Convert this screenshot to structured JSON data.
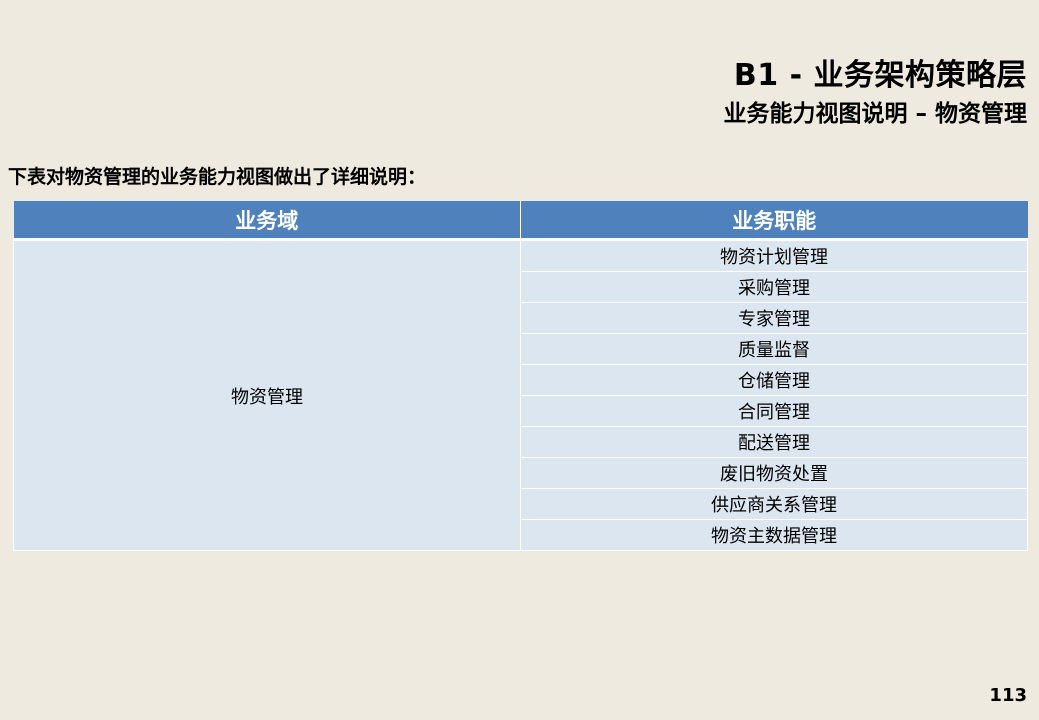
{
  "header": {
    "title": "B1 - 业务架构策略层",
    "subtitle": "业务能力视图说明 – 物资管理"
  },
  "intro": "下表对物资管理的业务能力视图做出了详细说明：",
  "table": {
    "headers": [
      "业务域",
      "业务职能"
    ],
    "domain": "物资管理",
    "functions": [
      "物资计划管理",
      "采购管理",
      "专家管理",
      "质量监督",
      "仓储管理",
      "合同管理",
      "配送管理",
      "废旧物资处置",
      "供应商关系管理",
      "物资主数据管理"
    ]
  },
  "page_number": "113",
  "colors": {
    "background": "#EEEAE0",
    "header_fill": "#4F81BD",
    "cell_fill": "#DCE6F1"
  }
}
